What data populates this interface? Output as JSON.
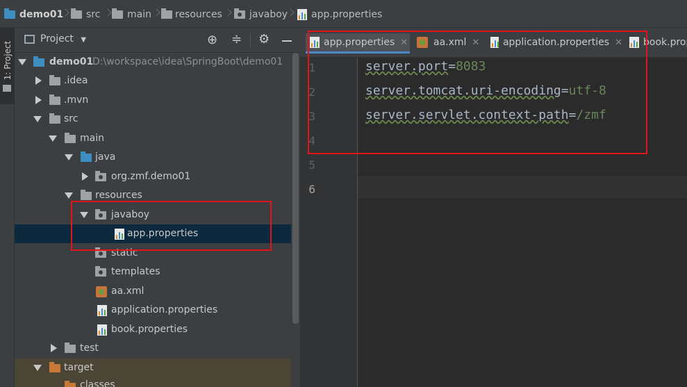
{
  "breadcrumb": [
    "demo01",
    "src",
    "main",
    "resources",
    "javaboy",
    "app.properties"
  ],
  "sidebar_stripe": {
    "label": "1: Project"
  },
  "project_panel": {
    "title": "Project",
    "toolbar_icons": [
      "locate-icon",
      "collapse-all-icon",
      "gear-icon",
      "minimize-icon"
    ]
  },
  "tree": {
    "root": {
      "label": "demo01",
      "path": "D:\\workspace\\idea\\SpringBoot\\demo01"
    },
    "idea": ".idea",
    "mvn": ".mvn",
    "src": "src",
    "main": "main",
    "java": "java",
    "package": "org.zmf.demo01",
    "resources": "resources",
    "javaboy": "javaboy",
    "app_properties": "app.properties",
    "static": "static",
    "templates": "templates",
    "aa_xml": "aa.xml",
    "application_properties": "application.properties",
    "book_properties": "book.properties",
    "test": "test",
    "target": "target",
    "classes": "classes"
  },
  "editor": {
    "tabs": [
      {
        "label": "app.properties",
        "active": true,
        "icon": "properties-file-icon"
      },
      {
        "label": "aa.xml",
        "active": false,
        "icon": "xml-file-icon"
      },
      {
        "label": "application.properties",
        "active": false,
        "icon": "properties-file-icon"
      },
      {
        "label": "book.prop",
        "active": false,
        "icon": "properties-file-icon"
      }
    ],
    "line_numbers": [
      "1",
      "2",
      "3",
      "4",
      "5",
      "6"
    ],
    "lines": [
      {
        "key": "server.port",
        "eq": "=",
        "value": "8083"
      },
      {
        "key": "server.tomcat.uri-encoding",
        "eq": "=",
        "value": "utf-8"
      },
      {
        "key": "server.servlet.context-path",
        "eq": "=",
        "value": "/zmf"
      }
    ]
  },
  "colors": {
    "highlight_border": "#e3131a",
    "selection": "#0d293e",
    "accent": "#4a88c7"
  }
}
